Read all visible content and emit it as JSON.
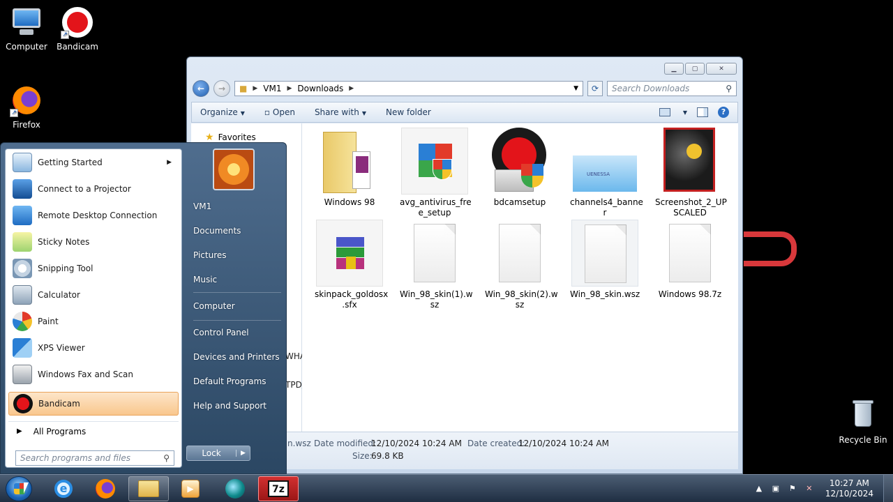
{
  "desktop": {
    "icons": [
      {
        "label": "Computer",
        "icon": "computer-icon"
      },
      {
        "label": "Bandicam",
        "icon": "bandicam-icon"
      },
      {
        "label": "Firefox",
        "icon": "firefox-icon"
      },
      {
        "label": "Recycle Bin",
        "icon": "recycle-bin-icon"
      }
    ]
  },
  "explorer": {
    "breadcrumb": [
      "VM1",
      "Downloads"
    ],
    "search_placeholder": "Search Downloads",
    "toolbar": {
      "organize": "Organize",
      "open": "Open",
      "share_with": "Share with",
      "new_folder": "New folder"
    },
    "nav": {
      "favorites": "Favorites",
      "trunc1": "WHA",
      "trunc2": "TPD/"
    },
    "files": [
      {
        "name": "Windows 98",
        "type": "folder"
      },
      {
        "name": "avg_antivirus_fre e_setup",
        "type": "installer"
      },
      {
        "name": "bdcamsetup",
        "type": "installer"
      },
      {
        "name": "channels4_banne r",
        "type": "image"
      },
      {
        "name": "Screenshot_2_UP SCALED",
        "type": "image"
      },
      {
        "name": "skinpack_goldosx .sfx",
        "type": "archive"
      },
      {
        "name": "Win_98_skin(1).w sz",
        "type": "file"
      },
      {
        "name": "Win_98_skin(2).w sz",
        "type": "file"
      },
      {
        "name": "Win_98_skin.wsz",
        "type": "file",
        "selected": true
      },
      {
        "name": "Windows 98.7z",
        "type": "file"
      }
    ],
    "details": {
      "name": "n.wsz",
      "date_modified_label": "Date modified:",
      "date_modified": "12/10/2024 10:24 AM",
      "date_created_label": "Date created:",
      "date_created": "12/10/2024 10:24 AM",
      "size_label": "Size:",
      "size": "69.8 KB"
    },
    "ch4_thumb_text": "UENESSA"
  },
  "start_menu": {
    "programs": [
      {
        "label": "Getting Started",
        "icon": "getting-started-icon",
        "submenu": true
      },
      {
        "label": "Connect to a Projector",
        "icon": "projector-icon"
      },
      {
        "label": "Remote Desktop Connection",
        "icon": "remote-desktop-icon"
      },
      {
        "label": "Sticky Notes",
        "icon": "sticky-notes-icon"
      },
      {
        "label": "Snipping Tool",
        "icon": "snipping-tool-icon"
      },
      {
        "label": "Calculator",
        "icon": "calculator-icon"
      },
      {
        "label": "Paint",
        "icon": "paint-icon"
      },
      {
        "label": "XPS Viewer",
        "icon": "xps-viewer-icon"
      },
      {
        "label": "Windows Fax and Scan",
        "icon": "fax-scan-icon"
      },
      {
        "label": "Bandicam",
        "icon": "bandicam-icon",
        "highlighted": true
      }
    ],
    "all_programs": "All Programs",
    "search_placeholder": "Search programs and files",
    "right_items": [
      "VM1",
      "Documents",
      "Pictures",
      "Music",
      "Computer",
      "Control Panel",
      "Devices and Printers",
      "Default Programs",
      "Help and Support"
    ],
    "lock": "Lock"
  },
  "taskbar": {
    "clock_time": "10:27 AM",
    "clock_date": "12/10/2024",
    "seven_zip_label": "7z"
  }
}
